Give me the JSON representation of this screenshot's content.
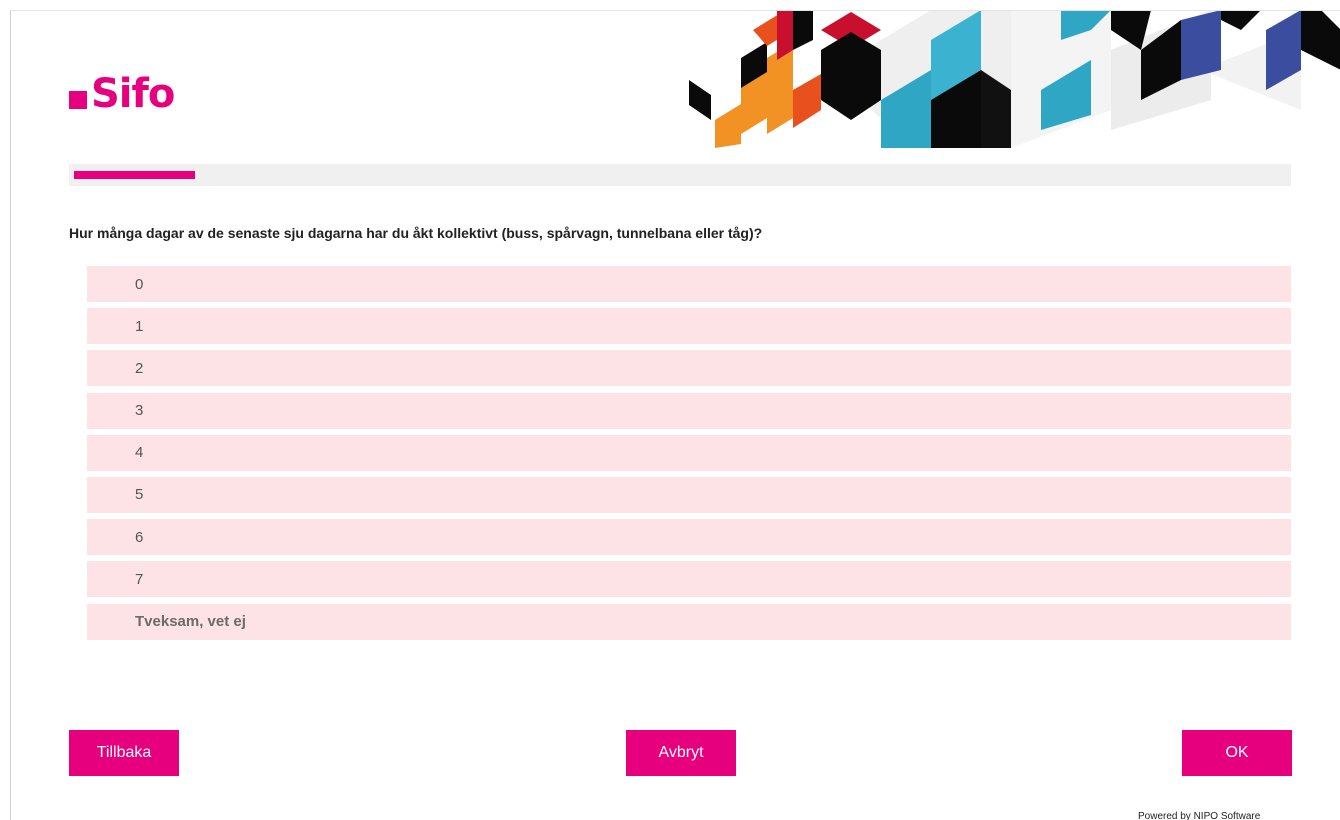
{
  "brand": {
    "logo_text": "Sifo",
    "accent_color": "#e6007e"
  },
  "progress": {
    "fraction": 0.1
  },
  "question": {
    "text": "Hur många dagar av de senaste sju dagarna har du åkt kollektivt (buss, spårvagn, tunnelbana eller tåg)?"
  },
  "options": [
    {
      "label": "0"
    },
    {
      "label": "1"
    },
    {
      "label": "2"
    },
    {
      "label": "3"
    },
    {
      "label": "4"
    },
    {
      "label": "5"
    },
    {
      "label": "6"
    },
    {
      "label": "7"
    },
    {
      "label": "Tveksam, vet ej"
    }
  ],
  "buttons": {
    "back_label": "Tillbaka",
    "cancel_label": "Avbryt",
    "ok_label": "OK"
  },
  "footer": {
    "powered_by": "Powered by NIPO Software"
  }
}
